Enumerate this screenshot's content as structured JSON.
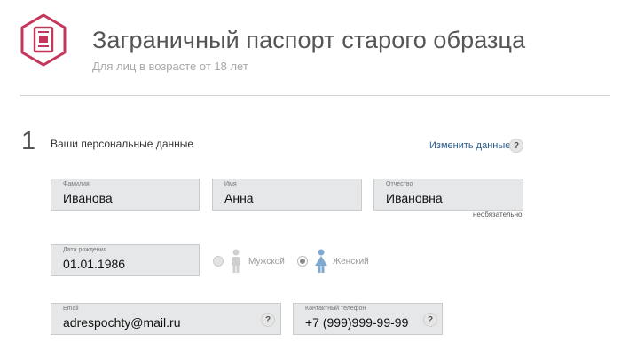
{
  "header": {
    "title": "Заграничный паспорт старого образца",
    "subtitle": "Для лиц в возрасте от 18 лет"
  },
  "section": {
    "number": "1",
    "title": "Ваши персональные данные",
    "change_link": "Изменить данные",
    "help": "?"
  },
  "fields": {
    "surname": {
      "label": "Фамилия",
      "value": "Иванова"
    },
    "name": {
      "label": "Имя",
      "value": "Анна"
    },
    "patronymic": {
      "label": "Отчество",
      "value": "Ивановна",
      "note": "необязательно"
    },
    "birthdate": {
      "label": "Дата рождения",
      "value": "01.01.1986"
    },
    "email": {
      "label": "Email",
      "value": "adrespochty@mail.ru",
      "help": "?"
    },
    "phone": {
      "label": "Контактный телефон",
      "value": "+7 (999)999-99-99",
      "help": "?"
    }
  },
  "gender": {
    "male": {
      "label": "Мужской",
      "selected": false
    },
    "female": {
      "label": "Женский",
      "selected": true
    }
  },
  "colors": {
    "brand": "#c4365a",
    "link": "#2a5d8c",
    "female_icon": "#7fa9cf",
    "male_icon": "#cfcfcf",
    "field_bg": "#e5e7e8"
  }
}
